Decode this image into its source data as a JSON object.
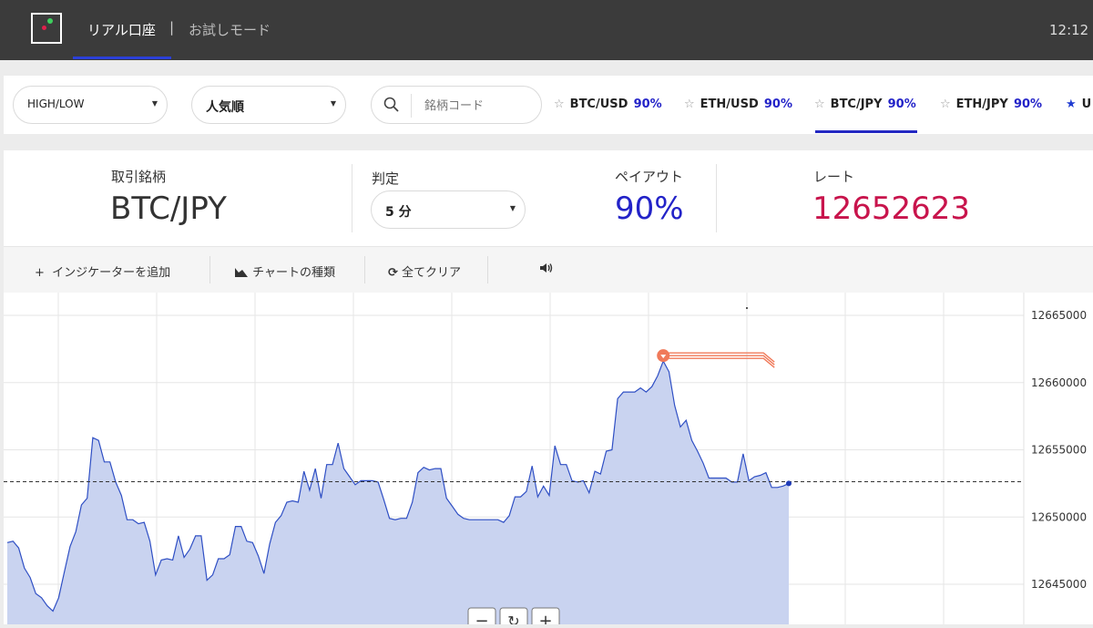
{
  "header": {
    "account_real": "リアル口座",
    "separator": "|",
    "account_demo": "お試しモード",
    "clock": "12:12"
  },
  "filters": {
    "option_type": "HIGH/LOW",
    "sort": "人気順",
    "search_placeholder": "銘柄コード"
  },
  "pair_tabs": [
    {
      "pair": "BTC/USD",
      "payout": "90%",
      "starred": false,
      "active": false
    },
    {
      "pair": "ETH/USD",
      "payout": "90%",
      "starred": false,
      "active": false
    },
    {
      "pair": "BTC/JPY",
      "payout": "90%",
      "starred": false,
      "active": true
    },
    {
      "pair": "ETH/JPY",
      "payout": "90%",
      "starred": false,
      "active": false
    },
    {
      "pair": "U",
      "payout": "",
      "starred": true,
      "active": false
    }
  ],
  "info": {
    "symbol_label": "取引銘柄",
    "symbol": "BTC/JPY",
    "judgement_label": "判定",
    "judgement_value": "5 分",
    "payout_label": "ペイアウト",
    "payout_value": "90%",
    "rate_label": "レート",
    "rate_value": "12652623",
    "payout_color": "#2323c8",
    "rate_color": "#c8144c"
  },
  "toolbar": {
    "add_indicator": "インジケーターを追加",
    "chart_type": "チャートの種類",
    "clear_all": "全てクリア"
  },
  "chart_data": {
    "type": "area",
    "ylim": [
      12642000,
      12667000
    ],
    "yticks": [
      12645000,
      12650000,
      12655000,
      12660000,
      12665000
    ],
    "current_rate": 12652623,
    "grid": true,
    "colors": {
      "line": "#2f4fc4",
      "fill": "#c9d3f0",
      "marker": "#f07a5a"
    },
    "values": [
      12648100,
      12648200,
      12647700,
      12646200,
      12645500,
      12644300,
      12644000,
      12643400,
      12643000,
      12644000,
      12645900,
      12647800,
      12648900,
      12650900,
      12651400,
      12655900,
      12655700,
      12654100,
      12654100,
      12652600,
      12651600,
      12649800,
      12649800,
      12649500,
      12649600,
      12648200,
      12645700,
      12646800,
      12646900,
      12646800,
      12648600,
      12647000,
      12647600,
      12648600,
      12648600,
      12645300,
      12645700,
      12646900,
      12646900,
      12647200,
      12649300,
      12649300,
      12648200,
      12648100,
      12647100,
      12645800,
      12648000,
      12649600,
      12650100,
      12651100,
      12651200,
      12651100,
      12653400,
      12652000,
      12653600,
      12651400,
      12653900,
      12653900,
      12655500,
      12653600,
      12653000,
      12652400,
      12652700,
      12652700,
      12652700,
      12652600,
      12651300,
      12649900,
      12649800,
      12649900,
      12649900,
      12651100,
      12653300,
      12653700,
      12653500,
      12653600,
      12653600,
      12651400,
      12650800,
      12650200,
      12649900,
      12649800,
      12649800,
      12649800,
      12649800,
      12649800,
      12649800,
      12649600,
      12650100,
      12651500,
      12651500,
      12651900,
      12653800,
      12651500,
      12652300,
      12651600,
      12655300,
      12653900,
      12653900,
      12652700,
      12652600,
      12652700,
      12651800,
      12653400,
      12653200,
      12654900,
      12655000,
      12658800,
      12659300,
      12659300,
      12659300,
      12659600,
      12659300,
      12659700,
      12660500,
      12661600,
      12660800,
      12658300,
      12656700,
      12657200,
      12655700,
      12654900,
      12654000,
      12652900,
      12652900,
      12652900,
      12652900,
      12652600,
      12652600,
      12654700,
      12652700,
      12653000,
      12653100,
      12653300,
      12652200,
      12652200,
      12652300,
      12652500
    ],
    "annotations": [
      {
        "type": "marker",
        "value": 12661600
      }
    ]
  }
}
